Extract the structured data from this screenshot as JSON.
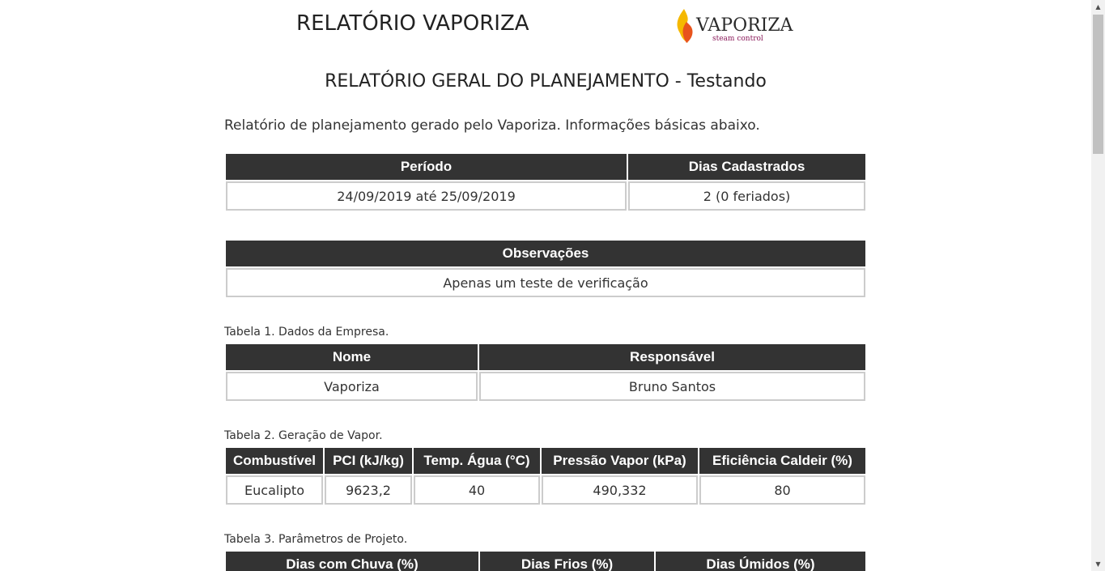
{
  "header": {
    "title": "RELATÓRIO VAPORIZA",
    "logo_text": "VAPORIZA",
    "logo_sub": "steam control"
  },
  "report": {
    "subtitle": "RELATÓRIO GERAL DO PLANEJAMENTO - Testando",
    "intro": "Relatório de planejamento gerado pelo Vaporiza. Informações básicas abaixo."
  },
  "summary": {
    "headers": [
      "Período",
      "Dias Cadastrados"
    ],
    "row": [
      "24/09/2019 até 25/09/2019",
      "2 (0 feriados)"
    ]
  },
  "observations": {
    "header": "Observações",
    "value": "Apenas um teste de verificação"
  },
  "table1": {
    "caption": "Tabela 1. Dados da Empresa.",
    "headers": [
      "Nome",
      "Responsável"
    ],
    "row": [
      "Vaporiza",
      "Bruno Santos"
    ]
  },
  "table2": {
    "caption": "Tabela 2. Geração de Vapor.",
    "headers": [
      "Combustível",
      "PCI (kJ/kg)",
      "Temp. Água (°C)",
      "Pressão Vapor (kPa)",
      "Eficiência Caldeir (%)"
    ],
    "row": [
      "Eucalipto",
      "9623,2",
      "40",
      "490,332",
      "80"
    ]
  },
  "table3": {
    "caption": "Tabela 3. Parâmetros de Projeto.",
    "headers": [
      "Dias com Chuva (%)",
      "Dias Frios (%)",
      "Dias Úmidos (%)"
    ]
  },
  "colors": {
    "header_bg": "#333333",
    "cell_border": "#cccccc",
    "logo_flame_yellow": "#f5b800",
    "logo_flame_orange": "#e8531c"
  },
  "icons": {
    "logo": "flame-icon",
    "scroll_up": "arrow-up-icon",
    "scroll_down": "arrow-down-icon"
  }
}
